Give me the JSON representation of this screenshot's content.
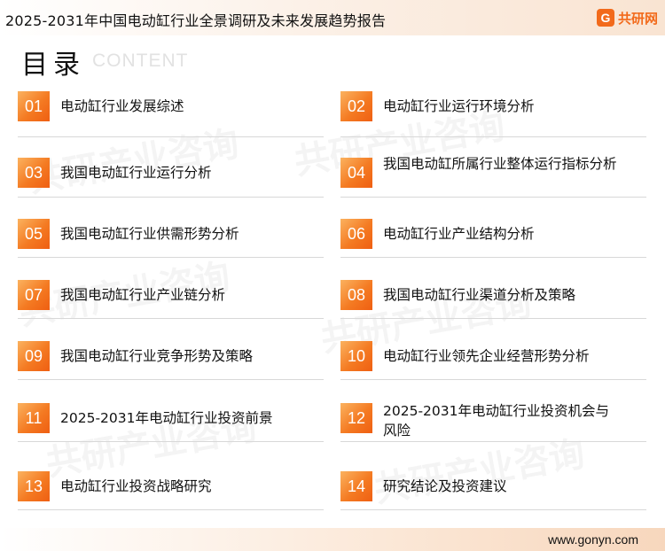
{
  "header": {
    "title": "2025-2031年中国电动缸行业全景调研及未来发展趋势报告",
    "logo_text": "共研网",
    "logo_mark": "G"
  },
  "toc": {
    "title": "目录",
    "subtitle": "CONTENT"
  },
  "items": [
    {
      "num": "01",
      "label": "电动缸行业发展综述"
    },
    {
      "num": "02",
      "label": "电动缸行业运行环境分析"
    },
    {
      "num": "03",
      "label": "我国电动缸行业运行分析"
    },
    {
      "num": "04",
      "label": "我国电动缸所属行业整体运行指标分析"
    },
    {
      "num": "05",
      "label": "我国电动缸行业供需形势分析"
    },
    {
      "num": "06",
      "label": "电动缸行业产业结构分析"
    },
    {
      "num": "07",
      "label": "我国电动缸行业产业链分析"
    },
    {
      "num": "08",
      "label": "我国电动缸行业渠道分析及策略"
    },
    {
      "num": "09",
      "label": "我国电动缸行业竞争形势及策略"
    },
    {
      "num": "10",
      "label": "电动缸行业领先企业经营形势分析"
    },
    {
      "num": "11",
      "label": "2025-2031年电动缸行业投资前景"
    },
    {
      "num": "12",
      "label": "2025-2031年电动缸行业投资机会与风险"
    },
    {
      "num": "13",
      "label": "电动缸行业投资战略研究"
    },
    {
      "num": "14",
      "label": "研究结论及投资建议"
    }
  ],
  "watermark": "共研产业咨询",
  "footer": {
    "url": "www.gonyn.com"
  },
  "colors": {
    "accent": "#f26a1b",
    "badge_light": "#fbb25f",
    "badge_dark": "#ef5f12"
  }
}
